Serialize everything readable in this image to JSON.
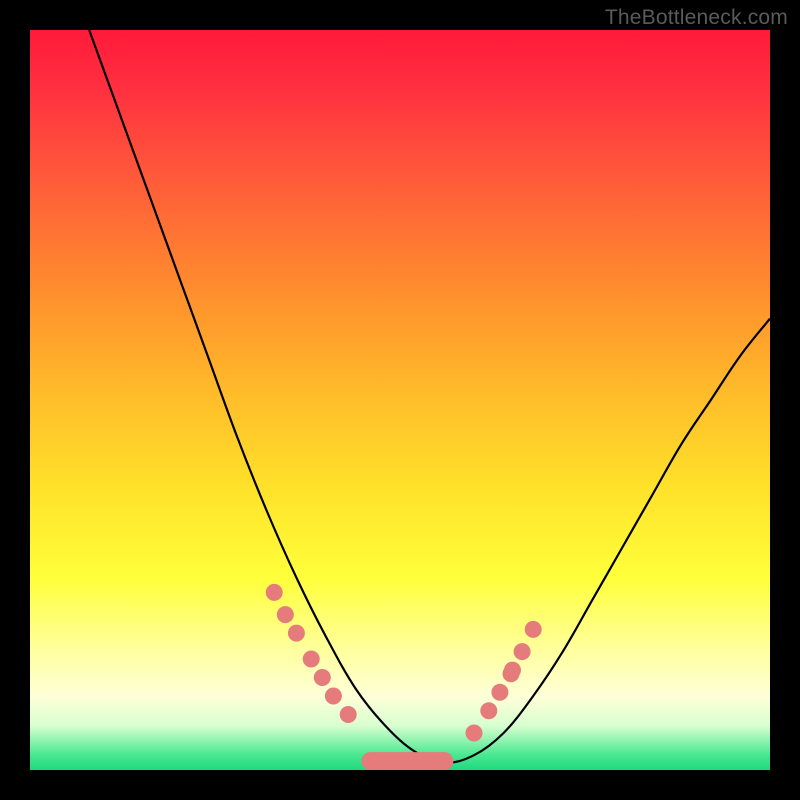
{
  "attribution": "TheBottleneck.com",
  "chart_data": {
    "type": "line",
    "title": "",
    "xlabel": "",
    "ylabel": "",
    "xlim": [
      0,
      100
    ],
    "ylim": [
      0,
      100
    ],
    "grid": false,
    "legend": false,
    "annotations": [],
    "series": [
      {
        "name": "curve",
        "color": "#000000",
        "x": [
          8,
          12,
          16,
          20,
          24,
          28,
          32,
          36,
          40,
          44,
          48,
          52,
          56,
          60,
          64,
          68,
          72,
          76,
          80,
          84,
          88,
          92,
          96,
          100
        ],
        "y": [
          100,
          89,
          78,
          67,
          56,
          45,
          35,
          26,
          18,
          11,
          6,
          2.5,
          1,
          2,
          5,
          10,
          16,
          23,
          30,
          37,
          44,
          50,
          56,
          61
        ]
      }
    ],
    "markers": [
      {
        "name": "left-dots",
        "color": "#e57b7b",
        "points": [
          {
            "x": 33,
            "y": 24.0
          },
          {
            "x": 34.5,
            "y": 21.0
          },
          {
            "x": 36,
            "y": 18.5
          },
          {
            "x": 38,
            "y": 15.0
          },
          {
            "x": 39.5,
            "y": 12.5
          },
          {
            "x": 41,
            "y": 10.0
          },
          {
            "x": 43,
            "y": 7.5
          }
        ]
      },
      {
        "name": "bottom-bar",
        "color": "#e57b7b",
        "shape": "capsule",
        "x_start": 46,
        "x_end": 56,
        "y": 1.2
      },
      {
        "name": "right-dots",
        "color": "#e57b7b",
        "points": [
          {
            "x": 60,
            "y": 5.0
          },
          {
            "x": 62,
            "y": 8.0
          },
          {
            "x": 63.5,
            "y": 10.5
          },
          {
            "x": 65,
            "y": 13.0
          },
          {
            "x": 65.2,
            "y": 13.5
          },
          {
            "x": 66.5,
            "y": 16.0
          },
          {
            "x": 68,
            "y": 19.0
          }
        ]
      }
    ],
    "background": {
      "type": "vertical-gradient",
      "stops": [
        {
          "pos": 0,
          "color": "#ff1a3a"
        },
        {
          "pos": 20,
          "color": "#ff5a3a"
        },
        {
          "pos": 48,
          "color": "#ffb82a"
        },
        {
          "pos": 74,
          "color": "#ffff3a"
        },
        {
          "pos": 94,
          "color": "#d8ffd0"
        },
        {
          "pos": 100,
          "color": "#20d880"
        }
      ]
    }
  }
}
